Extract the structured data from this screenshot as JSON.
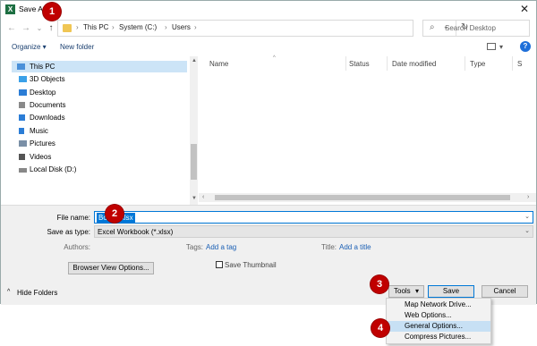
{
  "window": {
    "title": "Save As",
    "app_icon": "excel-icon",
    "close_glyph": "✕"
  },
  "nav": {
    "back_glyph": "←",
    "forward_glyph": "→",
    "recent_glyph": "⌄",
    "up_glyph": "↑",
    "breadcrumb": [
      "This PC",
      "System (C:)",
      "Users"
    ],
    "sep_glyph": "›",
    "refresh_glyph": "↻",
    "dropdown_glyph": "⌄",
    "search_placeholder": "Search Desktop",
    "search_glyph": "⌕"
  },
  "toolbar": {
    "organize": "Organize ▾",
    "new_folder": "New folder",
    "help": "?"
  },
  "sidebar": {
    "items": [
      {
        "label": "This PC",
        "icon": "computer-icon",
        "color": "#4a90d9"
      },
      {
        "label": "3D Objects",
        "icon": "cube-icon",
        "color": "#3aa0e8"
      },
      {
        "label": "Desktop",
        "icon": "desktop-icon",
        "color": "#2b7dd6"
      },
      {
        "label": "Documents",
        "icon": "document-icon",
        "color": "#8a8a8a"
      },
      {
        "label": "Downloads",
        "icon": "download-icon",
        "color": "#2b7dd6"
      },
      {
        "label": "Music",
        "icon": "music-icon",
        "color": "#2b7dd6"
      },
      {
        "label": "Pictures",
        "icon": "pictures-icon",
        "color": "#7a8fa6"
      },
      {
        "label": "Videos",
        "icon": "video-icon",
        "color": "#555555"
      },
      {
        "label": "Local Disk (D:)",
        "icon": "drive-icon",
        "color": "#888888"
      }
    ]
  },
  "columns": [
    "Name",
    "Status",
    "Date modified",
    "Type",
    "S"
  ],
  "form": {
    "file_name_label": "File name:",
    "file_name_value": "Book2.xlsx",
    "save_type_label": "Save as type:",
    "save_type_value": "Excel Workbook (*.xlsx)",
    "authors_label": "Authors:",
    "tags_label": "Tags:",
    "tags_link": "Add a tag",
    "title_label": "Title:",
    "title_link": "Add a title",
    "browser_view_btn": "Browser View Options...",
    "thumbnail_label": "Save Thumbnail",
    "hide_folders": "Hide Folders",
    "tools_btn": "Tools",
    "save_btn": "Save",
    "cancel_btn": "Cancel"
  },
  "tools_menu": {
    "items": [
      "Map Network Drive...",
      "Web Options...",
      "General Options...",
      "Compress Pictures..."
    ],
    "highlighted_index": 2
  },
  "callouts": [
    "1",
    "2",
    "3",
    "4"
  ]
}
